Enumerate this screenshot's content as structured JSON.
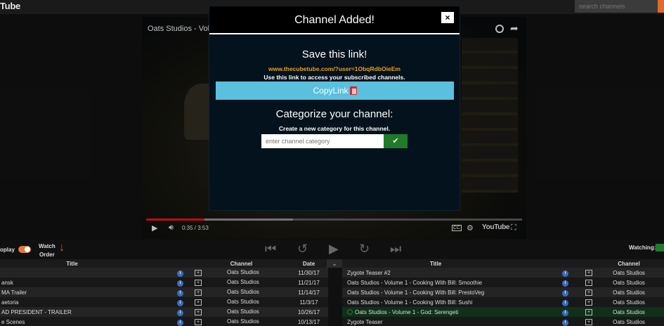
{
  "app": {
    "logo_text": "Tube"
  },
  "search": {
    "placeholder": "search channels"
  },
  "video": {
    "title": "Oats Studios - Vol",
    "time": "0:35 / 3:53",
    "progress_played": 0.155,
    "progress_buffered": 0.39,
    "youtube_label": "YouTube",
    "cc_label": "CC"
  },
  "controls": {
    "autoplay_label": "oplay",
    "watch_order_line1": "Watch",
    "watch_order_line2": "Order",
    "watching_label": "Watching:"
  },
  "left_table": {
    "headers": [
      "Title",
      "Channel",
      "Date"
    ],
    "rows": [
      {
        "title": "",
        "channel": "Oats Studios",
        "date": "11/30/17"
      },
      {
        "title": "ansk",
        "channel": "Oats Studios",
        "date": "11/21/17"
      },
      {
        "title": "MA Trailer",
        "channel": "Oats Studios",
        "date": "11/14/17"
      },
      {
        "title": "aetoria",
        "channel": "Oats Studios",
        "date": "11/3/17"
      },
      {
        "title": "AD PRESIDENT - TRAILER",
        "channel": "Oats Studios",
        "date": "10/26/17"
      },
      {
        "title": "e Scenes",
        "channel": "Oats Studios",
        "date": "10/13/17"
      }
    ]
  },
  "right_table": {
    "headers": [
      "Title",
      "Channel"
    ],
    "rows": [
      {
        "title": "Zygote Teaser #2",
        "channel": "Oats Studios"
      },
      {
        "title": "Oats Studios - Volume 1 - Cooking With Bill: Smoothie",
        "channel": "Oats Studios"
      },
      {
        "title": "Oats Studios - Volume 1 - Cooking With Bill: PrestoVeg",
        "channel": "Oats Studios"
      },
      {
        "title": "Oats Studios - Volume 1 - Cooking With Bill: Sushi",
        "channel": "Oats Studios"
      },
      {
        "title": "Oats Studios - Volume 1 - God: Serengeti",
        "channel": "Oats Studios"
      },
      {
        "title": "Zygote Teaser",
        "channel": "Oats Studios"
      }
    ]
  },
  "modal": {
    "title": "Channel Added!",
    "close_label": "×",
    "save_title": "Save this link!",
    "save_link": "www.thecubetube.com/?user=1ObqRdbOieEm",
    "save_help": "Use this link to access your subscribed channels.",
    "copy_label": "CopyLink",
    "categorize_title": "Categorize your channel:",
    "categorize_help": "Create a new category for this channel.",
    "category_placeholder": "enter channel category"
  },
  "colors": {
    "accent_orange": "#e06a2c",
    "copy_button": "#5bc0de",
    "submit_green": "#1f7a2a",
    "link_orange": "#e8a21a"
  }
}
